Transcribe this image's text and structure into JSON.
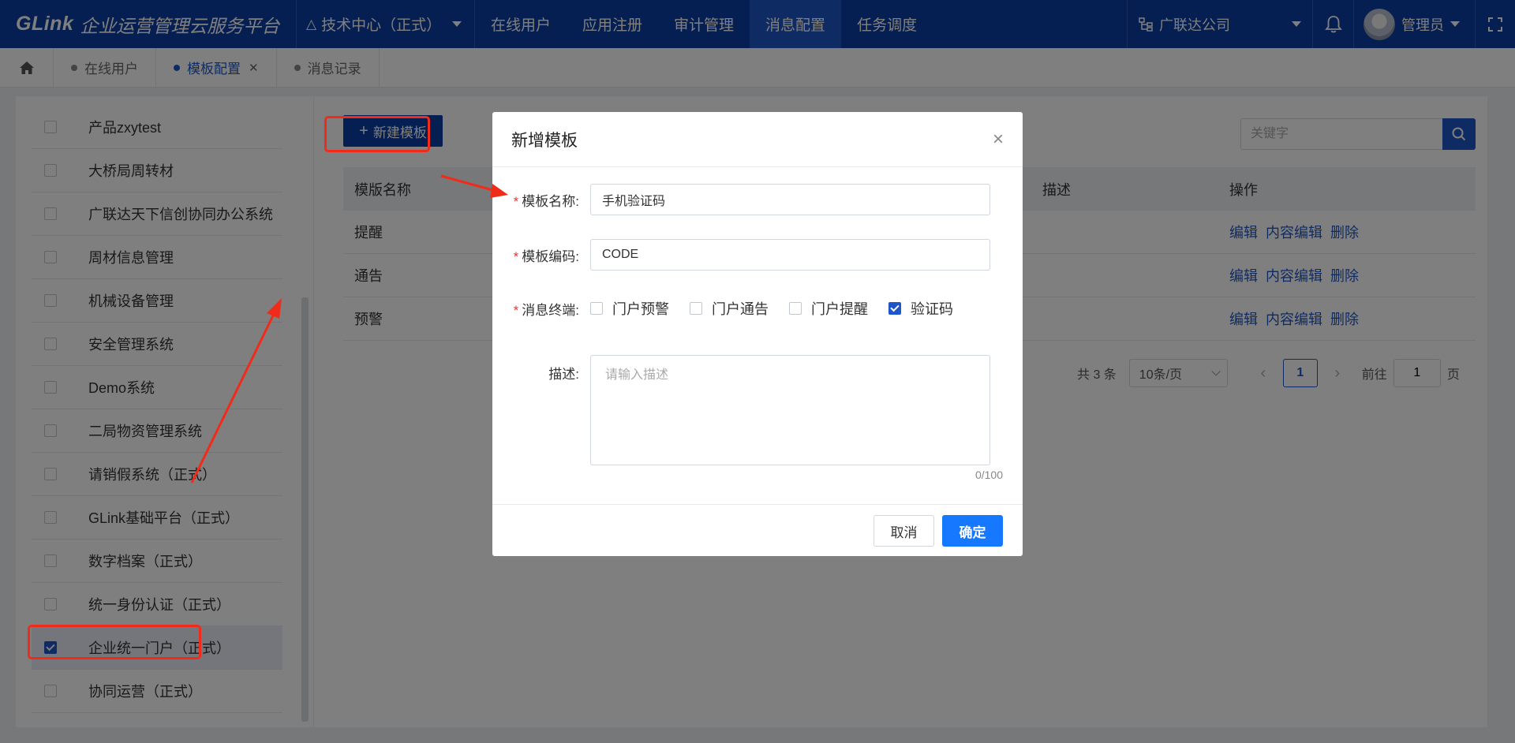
{
  "header": {
    "logo": "GLink",
    "platform_name": "企业运营管理云服务平台",
    "system_switch": "技术中心（正式）",
    "menu": [
      {
        "label": "在线用户",
        "active": false
      },
      {
        "label": "应用注册",
        "active": false
      },
      {
        "label": "审计管理",
        "active": false
      },
      {
        "label": "消息配置",
        "active": true
      },
      {
        "label": "任务调度",
        "active": false
      }
    ],
    "org": "广联达公司",
    "user": "管理员"
  },
  "tabs": [
    {
      "label": "在线用户",
      "active": false
    },
    {
      "label": "模板配置",
      "active": true,
      "closable": true
    },
    {
      "label": "消息记录",
      "active": false
    }
  ],
  "systems": [
    {
      "label": "产品zxytest",
      "checked": false
    },
    {
      "label": "大桥局周转材",
      "checked": false
    },
    {
      "label": "广联达天下信创协同办公系统",
      "checked": false
    },
    {
      "label": "周材信息管理",
      "checked": false
    },
    {
      "label": "机械设备管理",
      "checked": false
    },
    {
      "label": "安全管理系统",
      "checked": false
    },
    {
      "label": "Demo系统",
      "checked": false
    },
    {
      "label": "二局物资管理系统",
      "checked": false
    },
    {
      "label": "请销假系统（正式）",
      "checked": false
    },
    {
      "label": "GLink基础平台（正式）",
      "checked": false
    },
    {
      "label": "数字档案（正式）",
      "checked": false
    },
    {
      "label": "统一身份认证（正式）",
      "checked": false
    },
    {
      "label": "企业统一门户（正式）",
      "checked": true
    },
    {
      "label": "协同运营（正式）",
      "checked": false
    }
  ],
  "toolbar": {
    "new_label": "新建模板",
    "search_placeholder": "关键字"
  },
  "table": {
    "columns": {
      "name": "模版名称",
      "desc": "描述",
      "ops": "操作"
    },
    "rows": [
      {
        "name": "提醒",
        "ops": [
          "编辑",
          "内容编辑",
          "删除"
        ]
      },
      {
        "name": "通告",
        "ops": [
          "编辑",
          "内容编辑",
          "删除"
        ]
      },
      {
        "name": "预警",
        "ops": [
          "编辑",
          "内容编辑",
          "删除"
        ]
      }
    ]
  },
  "pagination": {
    "total": "共 3 条",
    "page_size": "10条/页",
    "current": "1",
    "goto_prefix": "前往",
    "goto_value": "1",
    "goto_suffix": "页"
  },
  "modal": {
    "title": "新增模板",
    "name_label": "模板名称:",
    "name_value": "手机验证码",
    "code_label": "模板编码:",
    "code_value": "CODE",
    "terminal_label": "消息终端:",
    "terminals": [
      {
        "label": "门户预警",
        "checked": false
      },
      {
        "label": "门户通告",
        "checked": false
      },
      {
        "label": "门户提醒",
        "checked": false
      },
      {
        "label": "验证码",
        "checked": true
      }
    ],
    "desc_label": "描述:",
    "desc_placeholder": "请输入描述",
    "counter": "0/100",
    "cancel": "取消",
    "confirm": "确定"
  },
  "colors": {
    "nav_bg": "#0d3ea6",
    "primary": "#1677ff",
    "annotation": "#f12b1a"
  }
}
